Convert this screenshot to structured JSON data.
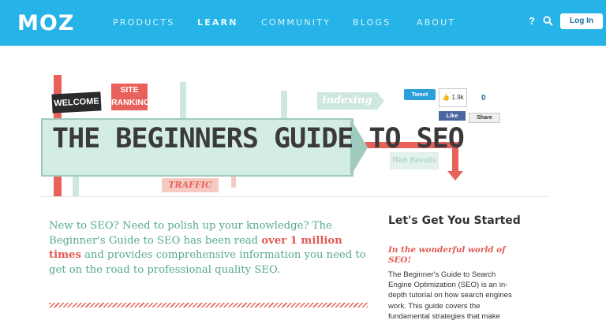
{
  "header": {
    "logo": "MOZ",
    "nav": [
      "PRODUCTS",
      "LEARN",
      "COMMUNITY",
      "BLOGS",
      "ABOUT"
    ],
    "help": "?",
    "login": "Log In"
  },
  "hero": {
    "title": "THE BEGINNERS GUIDE TO SEO",
    "welcome": "WELCOME",
    "site_ranking": "SITE RANKING",
    "indexing": "indexing",
    "web_results": "Web Results",
    "traffic": "TRAFFIC"
  },
  "social": {
    "tweet": "Tweet",
    "like_count": "1.9k",
    "fb_like": "Like",
    "share": "Share",
    "share_count": "0"
  },
  "intro": {
    "part1": "New to SEO? Need to polish up your knowledge? The Beginner's Guide to SEO has been read ",
    "highlight": "over 1 million times",
    "part2": " and provides comprehensive information you need to get on the road to professional quality SEO."
  },
  "sidebar": {
    "title": "Let's Get You Started",
    "subtitle": "In the wonderful world of SEO!",
    "body": "The Beginner's Guide to Search Engine Optimization (SEO) is an in-depth tutorial on how search engines work. This guide covers the fundamental strategies that make"
  },
  "colors": {
    "brand_blue": "#26b3e7",
    "accent_red": "#e8615a",
    "teal_text": "#56a994"
  }
}
